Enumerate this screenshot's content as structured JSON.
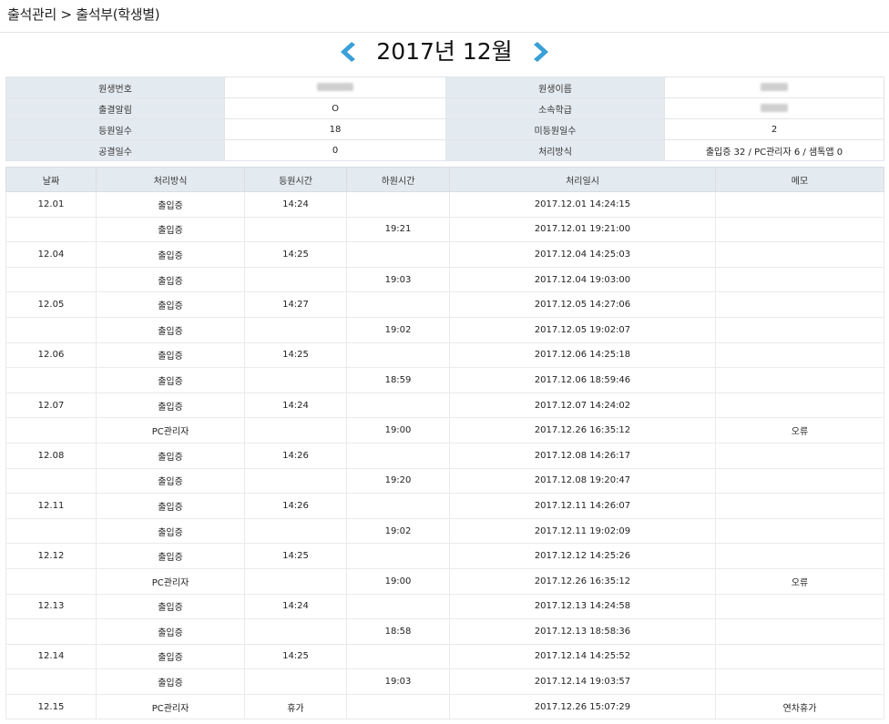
{
  "breadcrumb": "출석관리 > 출석부(학생별)",
  "month_title": "2017년 12월",
  "colors": {
    "arrow": "#3aa0d8",
    "label_bg": "#e4ebf0"
  },
  "icons": {
    "prev": "chevron-left-icon",
    "next": "chevron-right-icon"
  },
  "info": {
    "student_no_label": "원생번호",
    "student_name_label": "원생이름",
    "alert_label": "출결알림",
    "alert_value": "O",
    "class_label": "소속학급",
    "attend_days_label": "등원일수",
    "attend_days_value": "18",
    "absent_days_label": "미등원일수",
    "absent_days_value": "2",
    "holiday_days_label": "공결일수",
    "holiday_days_value": "0",
    "method_label": "처리방식",
    "method_value": "출입증 32 / PC관리자 6 /  샘톡앱 0"
  },
  "table": {
    "headers": [
      "날짜",
      "처리방식",
      "등원시간",
      "하원시간",
      "처리일시",
      "메모"
    ],
    "rows": [
      [
        "12.01",
        "출입증",
        "14:24",
        "",
        "2017.12.01 14:24:15",
        ""
      ],
      [
        "",
        "출입증",
        "",
        "19:21",
        "2017.12.01 19:21:00",
        ""
      ],
      [
        "12.04",
        "출입증",
        "14:25",
        "",
        "2017.12.04 14:25:03",
        ""
      ],
      [
        "",
        "출입증",
        "",
        "19:03",
        "2017.12.04 19:03:00",
        ""
      ],
      [
        "12.05",
        "출입증",
        "14:27",
        "",
        "2017.12.05 14:27:06",
        ""
      ],
      [
        "",
        "출입증",
        "",
        "19:02",
        "2017.12.05 19:02:07",
        ""
      ],
      [
        "12.06",
        "출입증",
        "14:25",
        "",
        "2017.12.06 14:25:18",
        ""
      ],
      [
        "",
        "출입증",
        "",
        "18:59",
        "2017.12.06 18:59:46",
        ""
      ],
      [
        "12.07",
        "출입증",
        "14:24",
        "",
        "2017.12.07 14:24:02",
        ""
      ],
      [
        "",
        "PC관리자",
        "",
        "19:00",
        "2017.12.26 16:35:12",
        "오류"
      ],
      [
        "12.08",
        "출입증",
        "14:26",
        "",
        "2017.12.08 14:26:17",
        ""
      ],
      [
        "",
        "출입증",
        "",
        "19:20",
        "2017.12.08 19:20:47",
        ""
      ],
      [
        "12.11",
        "출입증",
        "14:26",
        "",
        "2017.12.11 14:26:07",
        ""
      ],
      [
        "",
        "출입증",
        "",
        "19:02",
        "2017.12.11 19:02:09",
        ""
      ],
      [
        "12.12",
        "출입증",
        "14:25",
        "",
        "2017.12.12 14:25:26",
        ""
      ],
      [
        "",
        "PC관리자",
        "",
        "19:00",
        "2017.12.26 16:35:12",
        "오류"
      ],
      [
        "12.13",
        "출입증",
        "14:24",
        "",
        "2017.12.13 14:24:58",
        ""
      ],
      [
        "",
        "출입증",
        "",
        "18:58",
        "2017.12.13 18:58:36",
        ""
      ],
      [
        "12.14",
        "출입증",
        "14:25",
        "",
        "2017.12.14 14:25:52",
        ""
      ],
      [
        "",
        "출입증",
        "",
        "19:03",
        "2017.12.14 19:03:57",
        ""
      ],
      [
        "12.15",
        "PC관리자",
        "휴가",
        "",
        "2017.12.26 15:07:29",
        "연차휴가"
      ]
    ]
  }
}
